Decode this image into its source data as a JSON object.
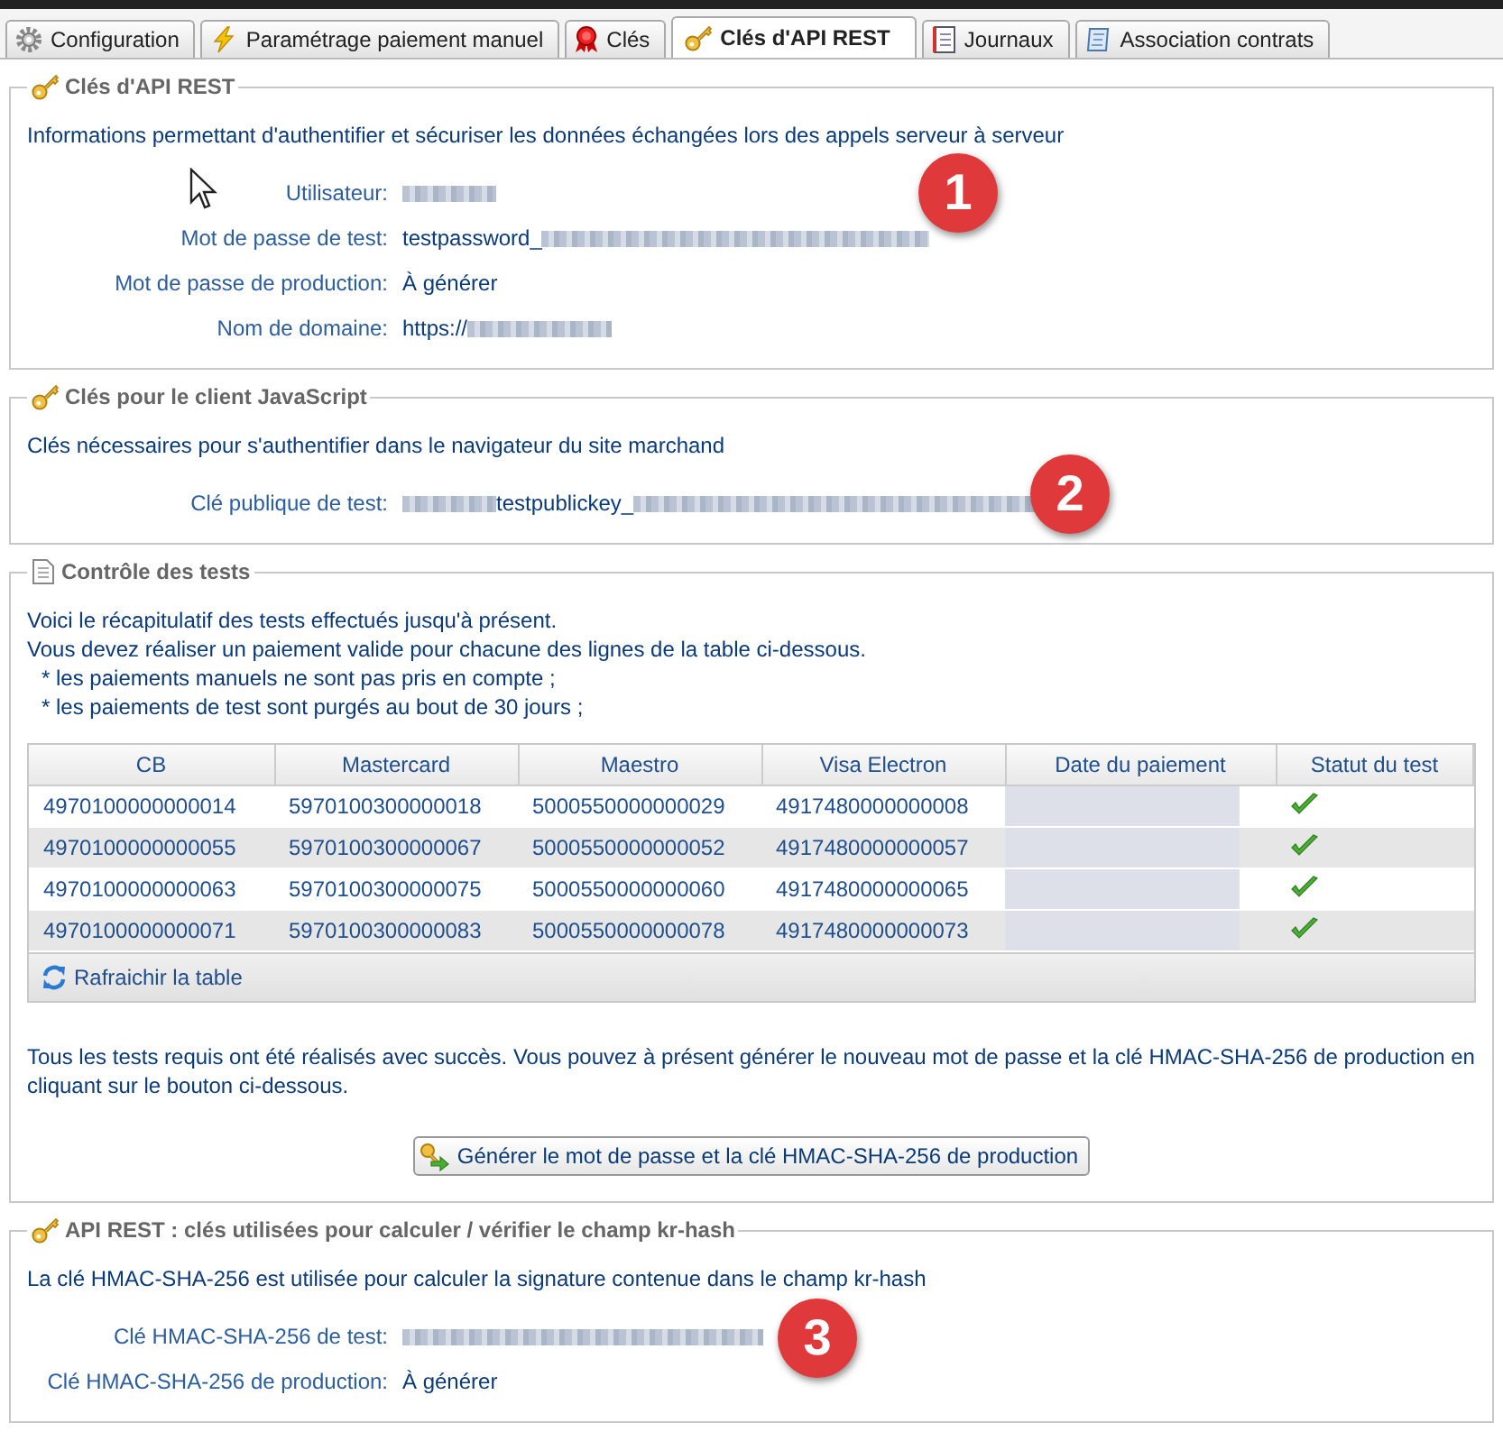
{
  "tabs": [
    {
      "label": "Configuration",
      "selected": false
    },
    {
      "label": "Paramétrage paiement manuel",
      "selected": false
    },
    {
      "label": "Clés",
      "selected": false
    },
    {
      "label": "Clés d'API REST",
      "selected": true
    },
    {
      "label": "Journaux",
      "selected": false
    },
    {
      "label": "Association contrats",
      "selected": false
    }
  ],
  "sections": [
    {
      "title": "Clés d'API REST",
      "intro": [
        "Informations permettant d'authentifier et sécuriser les données échangées lors des appels serveur à serveur"
      ],
      "fields": [
        {
          "label": "Utilisateur:",
          "value": [
            {
              "kind": "masked"
            }
          ]
        },
        {
          "label": "Mot de passe de test:",
          "value": [
            {
              "kind": "text",
              "text": "testpassword_"
            },
            {
              "kind": "masked"
            }
          ]
        },
        {
          "label": "Mot de passe de production:",
          "value": [
            {
              "kind": "text",
              "text": "À générer"
            }
          ]
        },
        {
          "label": "Nom de domaine:",
          "value": [
            {
              "kind": "text",
              "text": "https://"
            },
            {
              "kind": "masked"
            }
          ]
        }
      ],
      "callout": "1"
    },
    {
      "title": "Clés pour le client JavaScript",
      "intro": [
        "Clés nécessaires pour s'authentifier dans le navigateur du site marchand"
      ],
      "fields": [
        {
          "label": "Clé publique de test:",
          "value": [
            {
              "kind": "masked"
            },
            {
              "kind": "text",
              "text": "testpublickey_"
            },
            {
              "kind": "masked"
            }
          ]
        }
      ],
      "callout": "2"
    },
    {
      "title": "Contrôle des tests",
      "intro": [
        "Voici le récapitulatif des tests effectués jusqu'à présent.",
        "Vous devez réaliser un paiement valide pour chacune des lignes de la table ci-dessous."
      ],
      "bullets": [
        "* les paiements manuels ne sont pas pris en compte ;",
        "* les paiements de test sont purgés au bout de 30 jours ;"
      ],
      "table": {
        "columns": [
          "CB",
          "Mastercard",
          "Maestro",
          "Visa Electron",
          "Date du paiement",
          "Statut du test"
        ],
        "rows": [
          {
            "cells": [
              "4970100000000014",
              "5970100300000018",
              "5000550000000029",
              "4917480000000008"
            ],
            "date_masked": true,
            "passed": true
          },
          {
            "cells": [
              "4970100000000055",
              "5970100300000067",
              "5000550000000052",
              "4917480000000057"
            ],
            "date_masked": true,
            "passed": true
          },
          {
            "cells": [
              "4970100000000063",
              "5970100300000075",
              "5000550000000060",
              "4917480000000065"
            ],
            "date_masked": true,
            "passed": true
          },
          {
            "cells": [
              "4970100000000071",
              "5970100300000083",
              "5000550000000078",
              "4917480000000073"
            ],
            "date_masked": true,
            "passed": true
          }
        ],
        "refresh": "Rafraichir la table"
      },
      "note": "Tous les tests requis ont été réalisés avec succès. Vous pouvez à présent générer le nouveau mot de passe et la clé HMAC-SHA-256 de production en cliquant sur le bouton ci-dessous.",
      "button": "Générer le mot de passe et la clé HMAC-SHA-256 de production"
    },
    {
      "title": "API REST : clés utilisées pour calculer / vérifier le champ kr-hash",
      "intro": [
        "La clé HMAC-SHA-256 est utilisée pour calculer la signature contenue dans le champ kr-hash"
      ],
      "fields": [
        {
          "label": "Clé HMAC-SHA-256 de test:",
          "value": [
            {
              "kind": "masked"
            }
          ]
        },
        {
          "label": "Clé HMAC-SHA-256 de production:",
          "value": [
            {
              "kind": "text",
              "text": "À générer"
            }
          ]
        }
      ],
      "callout": "3"
    }
  ]
}
